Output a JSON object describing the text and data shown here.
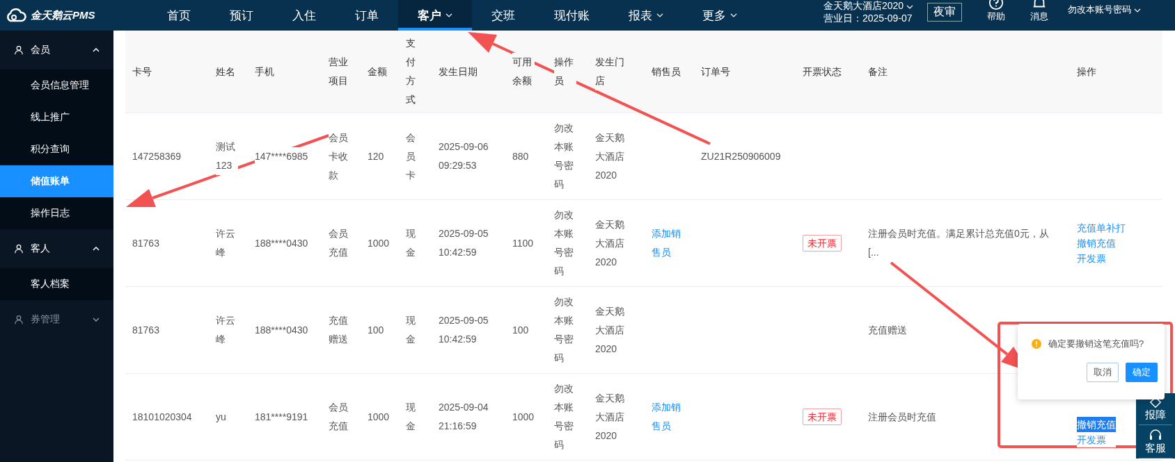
{
  "top_bar": {
    "logo": "金天鹅云PMS",
    "nav": [
      {
        "label": "首页",
        "selected": false,
        "dropdown": false
      },
      {
        "label": "预订",
        "selected": false,
        "dropdown": false
      },
      {
        "label": "入住",
        "selected": false,
        "dropdown": false
      },
      {
        "label": "订单",
        "selected": false,
        "dropdown": false
      },
      {
        "label": "客户",
        "selected": true,
        "dropdown": true
      },
      {
        "label": "交班",
        "selected": false,
        "dropdown": false
      },
      {
        "label": "现付账",
        "selected": false,
        "dropdown": false
      },
      {
        "label": "报表",
        "selected": false,
        "dropdown": true
      },
      {
        "label": "更多",
        "selected": false,
        "dropdown": true
      }
    ],
    "hotel": "金天鹅大酒店2020",
    "business_date": "营业日：2025-09-07",
    "night_audit": "夜审",
    "help": "帮助",
    "messages": "消息",
    "user": "勿改本账号密码"
  },
  "sidebar": {
    "groups": [
      {
        "label": "会员",
        "expanded": true,
        "items": [
          {
            "label": "会员信息管理",
            "selected": false
          },
          {
            "label": "线上推广",
            "selected": false
          },
          {
            "label": "积分查询",
            "selected": false
          },
          {
            "label": "储值账单",
            "selected": true
          },
          {
            "label": "操作日志",
            "selected": false
          }
        ]
      },
      {
        "label": "客人",
        "expanded": true,
        "items": [
          {
            "label": "客人档案",
            "selected": false
          }
        ]
      },
      {
        "label": "券管理",
        "expanded": false
      }
    ]
  },
  "table": {
    "columns": [
      "卡号",
      "姓名",
      "手机",
      "营业项目",
      "金额",
      "支付方式",
      "发生日期",
      "可用余额",
      "操作员",
      "发生门店",
      "销售员",
      "订单号",
      "开票状态",
      "备注",
      "操作"
    ],
    "rows": [
      {
        "card_no": "147258369",
        "name": "测试123",
        "phone": "147****6985",
        "business_item": "会员卡收款",
        "amount": "120",
        "payment": "会员卡",
        "date": "2025-09-06 09:29:53",
        "balance": "880",
        "operator": "勿改本账号密码",
        "store": "金天鹅大酒店2020",
        "order_no": "ZU21R250906009"
      },
      {
        "card_no": "81763",
        "name": "许云峰",
        "phone": "188****0430",
        "business_item": "会员充值",
        "amount": "1000",
        "payment": "现金",
        "date": "2025-09-05 10:42:59",
        "balance": "1100",
        "operator": "勿改本账号密码",
        "store": "金天鹅大酒店2020",
        "seller_link": "添加销售员",
        "invoice_status": "未开票",
        "remark": "注册会员时充值。满足累计总充值0元，从[...",
        "actions": [
          {
            "label": "充值单补打",
            "highlighted": false
          },
          {
            "label": "撤销充值",
            "highlighted": false
          },
          {
            "label": "开发票",
            "highlighted": false
          }
        ]
      },
      {
        "card_no": "81763",
        "name": "许云峰",
        "phone": "188****0430",
        "business_item": "充值赠送",
        "amount": "100",
        "payment": "现金",
        "date": "2025-09-05 10:42:59",
        "balance": "100",
        "operator": "勿改本账号密码",
        "store": "金天鹅大酒店2020",
        "remark": "充值赠送"
      },
      {
        "card_no": "18101020304",
        "name": "yu",
        "phone": "181****9191",
        "business_item": "会员充值",
        "amount": "1000",
        "payment": "现金",
        "date": "2025-09-04 21:16:59",
        "balance": "1000",
        "operator": "勿改本账号密码",
        "store": "金天鹅大酒店2020",
        "seller_link": "添加销售员",
        "invoice_status": "未开票",
        "remark": "注册会员时充值",
        "actions": [
          {
            "label": "撤销充值",
            "highlighted": true
          },
          {
            "label": "开发票",
            "highlighted": false
          }
        ]
      }
    ]
  },
  "confirm_popup": {
    "message": "确定要撤销这笔充值吗?",
    "cancel": "取消",
    "ok": "确定"
  },
  "side_tools": [
    {
      "label": "报障",
      "kind": "report"
    },
    {
      "label": "客服",
      "kind": "service"
    }
  ]
}
